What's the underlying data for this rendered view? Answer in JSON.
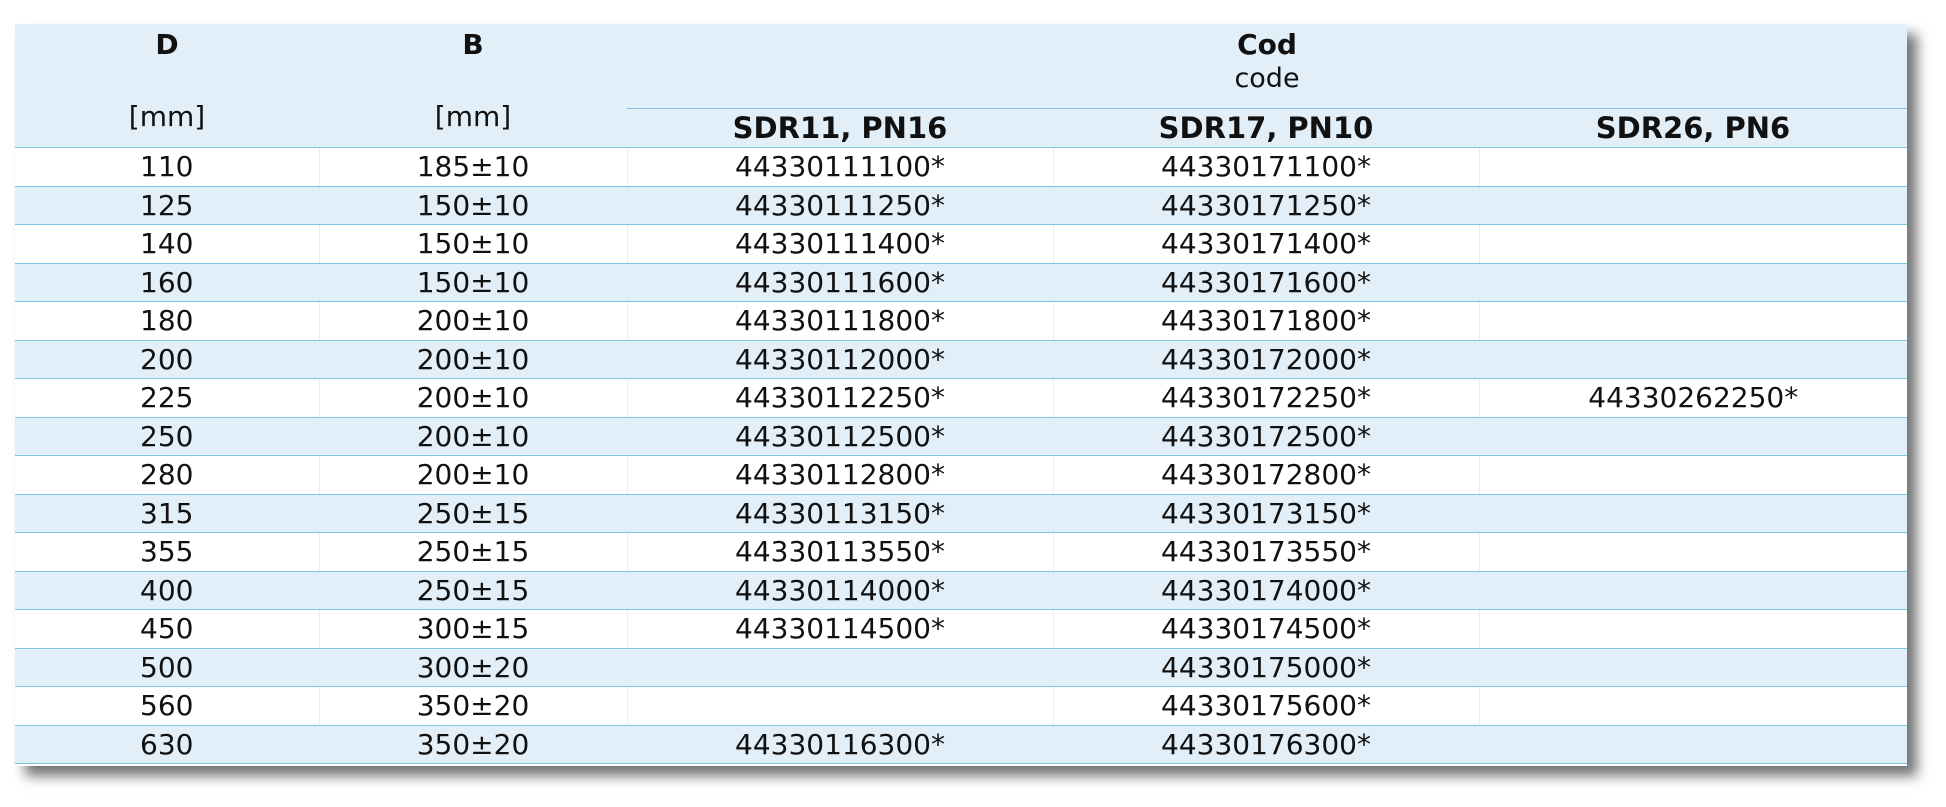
{
  "header": {
    "d_label": "D",
    "d_unit": "[mm]",
    "b_label": "B",
    "b_unit": "[mm]",
    "cod_label": "Cod",
    "cod_sub": "code",
    "sdr": [
      "SDR11, PN16",
      "SDR17, PN10",
      "SDR26, PN6"
    ]
  },
  "rows": [
    [
      "110",
      "185±10",
      "44330111100*",
      "44330171100*",
      ""
    ],
    [
      "125",
      "150±10",
      "44330111250*",
      "44330171250*",
      ""
    ],
    [
      "140",
      "150±10",
      "44330111400*",
      "44330171400*",
      ""
    ],
    [
      "160",
      "150±10",
      "44330111600*",
      "44330171600*",
      ""
    ],
    [
      "180",
      "200±10",
      "44330111800*",
      "44330171800*",
      ""
    ],
    [
      "200",
      "200±10",
      "44330112000*",
      "44330172000*",
      ""
    ],
    [
      "225",
      "200±10",
      "44330112250*",
      "44330172250*",
      "44330262250*"
    ],
    [
      "250",
      "200±10",
      "44330112500*",
      "44330172500*",
      ""
    ],
    [
      "280",
      "200±10",
      "44330112800*",
      "44330172800*",
      ""
    ],
    [
      "315",
      "250±15",
      "44330113150*",
      "44330173150*",
      ""
    ],
    [
      "355",
      "250±15",
      "44330113550*",
      "44330173550*",
      ""
    ],
    [
      "400",
      "250±15",
      "44330114000*",
      "44330174000*",
      ""
    ],
    [
      "450",
      "300±15",
      "44330114500*",
      "44330174500*",
      ""
    ],
    [
      "500",
      "300±20",
      "",
      "44330175000*",
      ""
    ],
    [
      "560",
      "350±20",
      "",
      "44330175600*",
      ""
    ],
    [
      "630",
      "350±20",
      "44330116300*",
      "44330176300*",
      ""
    ]
  ]
}
